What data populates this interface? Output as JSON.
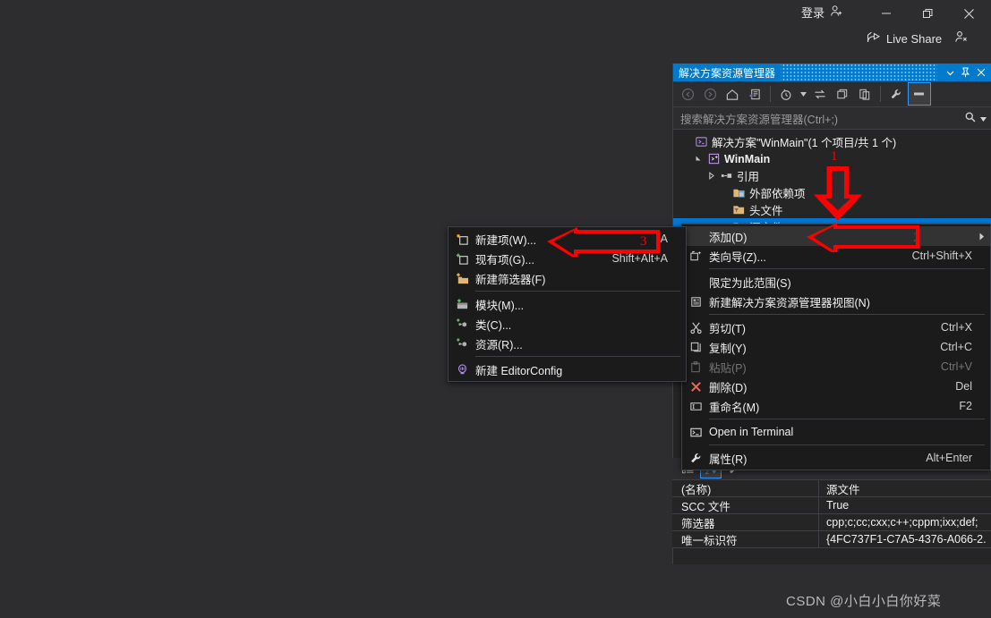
{
  "titlebar": {
    "signin_label": "登录",
    "signin_icon": "add-user-icon",
    "minimize_icon": "minimize-icon",
    "restore_icon": "restore-icon",
    "close_icon": "close-icon",
    "liveshare_label": "Live Share",
    "liveshare_icon": "share-icon",
    "pin_icon": "feedback-person-icon"
  },
  "solution_explorer": {
    "title": "解决方案资源管理器",
    "header_buttons": [
      {
        "name": "dropdown-chevron-icon",
        "glyph": "▾"
      },
      {
        "name": "pin-icon",
        "glyph": "pin"
      },
      {
        "name": "close-icon",
        "glyph": "✕"
      }
    ],
    "toolbar": [
      {
        "name": "back-icon",
        "state": "disabled"
      },
      {
        "name": "forward-icon",
        "state": "disabled"
      },
      {
        "name": "home-icon",
        "state": "normal"
      },
      {
        "name": "solution-view-icon",
        "state": "normal"
      },
      {
        "name": "pending-changes-icon",
        "state": "normal"
      },
      {
        "name": "sync-with-active-document-icon",
        "state": "normal"
      },
      {
        "name": "collapse-all-icon",
        "state": "normal"
      },
      {
        "name": "show-all-files-icon",
        "state": "normal"
      },
      {
        "name": "properties-icon",
        "state": "normal"
      },
      {
        "name": "preview-selected-items-icon",
        "state": "selected"
      }
    ],
    "search_placeholder": "搜索解决方案资源管理器(Ctrl+;)",
    "search_value": "",
    "search_icon": "search-icon",
    "search_dropdown_icon": "chevron-down-icon",
    "tree": [
      {
        "label": "解决方案\"WinMain\"(1 个项目/共 1 个)",
        "indent": 0,
        "twisty": "",
        "icon": "solution-icon",
        "bold": false,
        "selected": false
      },
      {
        "label": "WinMain",
        "indent": 1,
        "twisty": "▴",
        "icon": "cpp-project-icon",
        "bold": true,
        "selected": false
      },
      {
        "label": "引用",
        "indent": 2,
        "twisty": "▸",
        "icon": "references-icon",
        "bold": false,
        "selected": false
      },
      {
        "label": "外部依赖项",
        "indent": 3,
        "twisty": "",
        "icon": "external-deps-icon",
        "bold": false,
        "selected": false
      },
      {
        "label": "头文件",
        "indent": 3,
        "twisty": "",
        "icon": "folder-filter-icon",
        "bold": false,
        "selected": false
      },
      {
        "label": "源文件",
        "indent": 3,
        "twisty": "",
        "icon": "folder-filter-icon",
        "bold": false,
        "selected": true
      }
    ]
  },
  "context_menu_main": {
    "items": [
      {
        "label": "添加(D)",
        "shortcut": "",
        "icon": "",
        "submenu": true,
        "highlight": true,
        "disabled": false
      },
      {
        "label": "类向导(Z)...",
        "shortcut": "Ctrl+Shift+X",
        "icon": "class-wizard-icon",
        "submenu": false,
        "highlight": false,
        "disabled": false
      },
      {
        "separator": true
      },
      {
        "label": "限定为此范围(S)",
        "shortcut": "",
        "icon": "",
        "submenu": false,
        "highlight": false,
        "disabled": false
      },
      {
        "label": "新建解决方案资源管理器视图(N)",
        "shortcut": "",
        "icon": "new-solution-view-icon",
        "submenu": false,
        "highlight": false,
        "disabled": false
      },
      {
        "separator": true
      },
      {
        "label": "剪切(T)",
        "shortcut": "Ctrl+X",
        "icon": "cut-icon",
        "submenu": false,
        "highlight": false,
        "disabled": false
      },
      {
        "label": "复制(Y)",
        "shortcut": "Ctrl+C",
        "icon": "copy-icon",
        "submenu": false,
        "highlight": false,
        "disabled": false
      },
      {
        "label": "粘贴(P)",
        "shortcut": "Ctrl+V",
        "icon": "paste-icon",
        "submenu": false,
        "highlight": false,
        "disabled": true
      },
      {
        "label": "删除(D)",
        "shortcut": "Del",
        "icon": "delete-x-icon",
        "submenu": false,
        "highlight": false,
        "disabled": false
      },
      {
        "label": "重命名(M)",
        "shortcut": "F2",
        "icon": "rename-icon",
        "submenu": false,
        "highlight": false,
        "disabled": false
      },
      {
        "separator": true
      },
      {
        "label": "Open in Terminal",
        "shortcut": "",
        "icon": "terminal-icon",
        "submenu": false,
        "highlight": false,
        "disabled": false
      },
      {
        "separator": true
      },
      {
        "label": "属性(R)",
        "shortcut": "Alt+Enter",
        "icon": "wrench-icon",
        "submenu": false,
        "highlight": false,
        "disabled": false
      }
    ]
  },
  "context_menu_add": {
    "items": [
      {
        "label": "新建项(W)...",
        "shortcut": "Ctrl+Shift+A",
        "icon": "new-item-icon",
        "highlight": false,
        "disabled": false
      },
      {
        "label": "现有项(G)...",
        "shortcut": "Shift+Alt+A",
        "icon": "existing-item-icon",
        "highlight": false,
        "disabled": false
      },
      {
        "label": "新建筛选器(F)",
        "shortcut": "",
        "icon": "new-filter-icon",
        "highlight": false,
        "disabled": false
      },
      {
        "separator": true
      },
      {
        "label": "模块(M)...",
        "shortcut": "",
        "icon": "module-icon",
        "highlight": false,
        "disabled": false
      },
      {
        "label": "类(C)...",
        "shortcut": "",
        "icon": "class-icon",
        "highlight": false,
        "disabled": false
      },
      {
        "label": "资源(R)...",
        "shortcut": "",
        "icon": "resource-icon",
        "highlight": false,
        "disabled": false
      },
      {
        "separator": true
      },
      {
        "label": "新建 EditorConfig",
        "shortcut": "",
        "icon": "editorconfig-icon",
        "highlight": false,
        "disabled": false
      }
    ]
  },
  "properties": {
    "toolbar": [
      {
        "name": "categorized-icon",
        "active": false
      },
      {
        "name": "alphabetical-sort-icon",
        "active": true
      },
      {
        "name": "property-pages-icon",
        "active": false
      }
    ],
    "rows": [
      {
        "name": "(名称)",
        "value": "源文件"
      },
      {
        "name": "SCC 文件",
        "value": "True"
      },
      {
        "name": "筛选器",
        "value": "cpp;c;cc;cxx;c++;cppm;ixx;def;"
      },
      {
        "name": "唯一标识符",
        "value": "{4FC737F1-C7A5-4376-A066-2."
      }
    ]
  },
  "annotations": {
    "color": "#ff0000",
    "markers": [
      {
        "label": "1",
        "kind": "down-arrow"
      },
      {
        "label": "2",
        "kind": "left-arrow"
      },
      {
        "label": "3",
        "kind": "left-arrow"
      }
    ]
  },
  "watermark": {
    "text": "CSDN @小白小白你好菜"
  },
  "colors": {
    "background": "#2d2d30",
    "panel": "#252526",
    "accent": "#007acc",
    "selection": "#0078d7",
    "menu_bg": "#1b1b1c",
    "annotation_red": "#ff0000"
  }
}
